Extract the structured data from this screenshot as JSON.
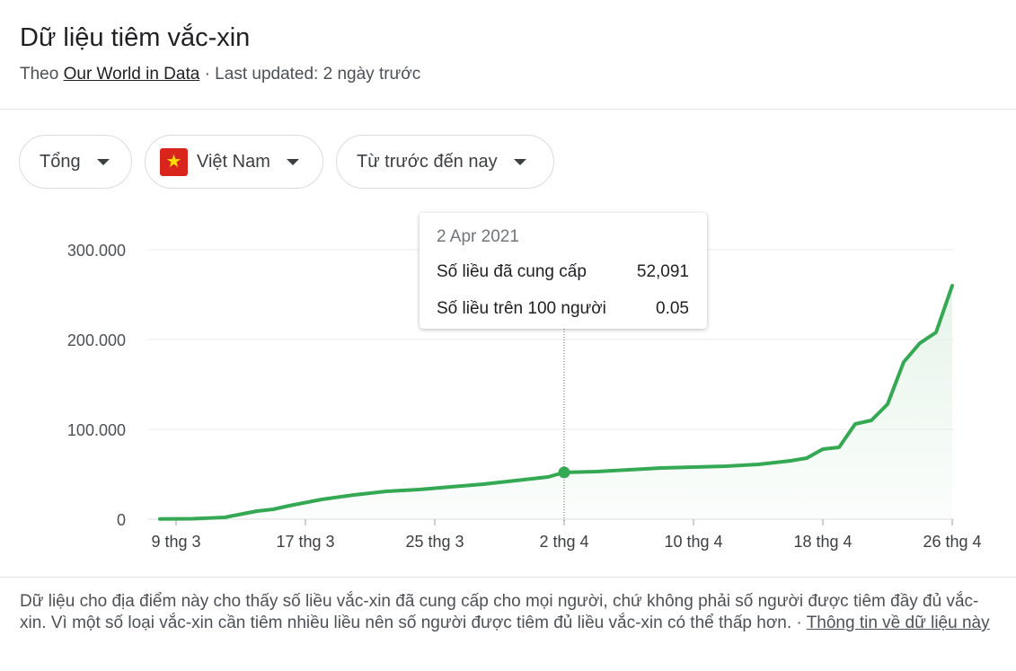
{
  "header": {
    "title": "Dữ liệu tiêm vắc-xin",
    "source_prefix": "Theo",
    "source_link": "Our World in Data",
    "updated": "· Last updated: 2 ngày trước"
  },
  "filters": {
    "metric": "Tổng",
    "country": "Việt Nam",
    "flag_star": "★",
    "range": "Từ trước đến nay"
  },
  "tooltip": {
    "date": "2 Apr 2021",
    "row1_label": "Số liều đã cung cấp",
    "row1_value": "52,091",
    "row2_label": "Số liều trên 100 người",
    "row2_value": "0.05"
  },
  "colors": {
    "line": "#34a853",
    "fill": "#e6f4ea",
    "grid": "#e8eaed"
  },
  "chart_data": {
    "type": "area",
    "x": [
      "2021-03-08",
      "2021-03-10",
      "2021-03-12",
      "2021-03-14",
      "2021-03-15",
      "2021-03-16",
      "2021-03-18",
      "2021-03-20",
      "2021-03-22",
      "2021-03-24",
      "2021-03-26",
      "2021-03-28",
      "2021-03-30",
      "2021-04-01",
      "2021-04-02",
      "2021-04-04",
      "2021-04-06",
      "2021-04-08",
      "2021-04-10",
      "2021-04-12",
      "2021-04-14",
      "2021-04-16",
      "2021-04-17",
      "2021-04-18",
      "2021-04-19",
      "2021-04-20",
      "2021-04-21",
      "2021-04-22",
      "2021-04-23",
      "2021-04-24",
      "2021-04-25",
      "2021-04-26"
    ],
    "series": [
      {
        "values": [
          200,
          500,
          2000,
          9000,
          11000,
          15000,
          22000,
          27000,
          31000,
          33000,
          36000,
          39000,
          43000,
          47000,
          52091,
          53000,
          55000,
          57000,
          58000,
          59000,
          61000,
          65000,
          68000,
          78000,
          80000,
          106000,
          110000,
          128000,
          175000,
          196000,
          208000,
          260000
        ]
      }
    ],
    "highlight": {
      "x": "2021-04-02",
      "value": 52091
    },
    "ylim": [
      0,
      300000
    ],
    "yticks": [
      {
        "value": 0,
        "label": "0"
      },
      {
        "value": 100000,
        "label": "100.000"
      },
      {
        "value": 200000,
        "label": "200.000"
      },
      {
        "value": 300000,
        "label": "300.000"
      }
    ],
    "xticks": [
      {
        "x": "2021-03-09",
        "label": "9 thg 3"
      },
      {
        "x": "2021-03-17",
        "label": "17 thg 3"
      },
      {
        "x": "2021-03-25",
        "label": "25 thg 3"
      },
      {
        "x": "2021-04-02",
        "label": "2 thg 4"
      },
      {
        "x": "2021-04-10",
        "label": "10 thg 4"
      },
      {
        "x": "2021-04-18",
        "label": "18 thg 4"
      },
      {
        "x": "2021-04-26",
        "label": "26 thg 4"
      }
    ],
    "xlim": [
      "2021-03-08",
      "2021-04-26"
    ],
    "grid": true
  },
  "footnote": {
    "text": "Dữ liệu cho địa điểm này cho thấy số liều vắc-xin đã cung cấp cho mọi người, chứ không phải số người được tiêm đầy đủ vắc-xin. Vì một số loại vắc-xin cần tiêm nhiều liều nên số người được tiêm đủ liều vắc-xin có thể thấp hơn.",
    "separator": " · ",
    "link": "Thông tin về dữ liệu này"
  }
}
